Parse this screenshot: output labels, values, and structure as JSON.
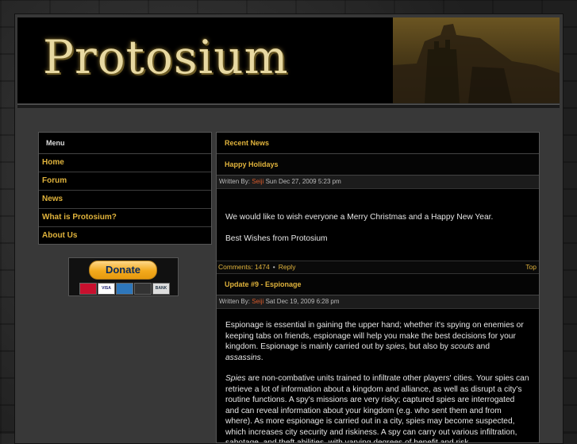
{
  "site": {
    "title": "Protosium"
  },
  "menu": {
    "heading": "Menu",
    "items": [
      {
        "label": "Home"
      },
      {
        "label": "Forum"
      },
      {
        "label": "News"
      },
      {
        "label": "What is Protosium?"
      },
      {
        "label": "About Us"
      }
    ]
  },
  "donate": {
    "button_label": "Donate",
    "cards": [
      "MasterCard",
      "VISA",
      "AMEX",
      "DISCOVER",
      "BANK"
    ]
  },
  "news": {
    "heading": "Recent News",
    "posts": [
      {
        "title": "Happy Holidays",
        "written_by_label": "Written By:",
        "author": "Seiji",
        "date": "Sun Dec 27, 2009 5:23 pm",
        "paragraphs": [
          "We would like to wish everyone a Merry Christmas and a Happy New Year.",
          "Best Wishes from Protosium"
        ],
        "comments_label": "Comments: 1474",
        "separator": "•",
        "reply_label": "Reply",
        "top_label": "Top"
      },
      {
        "title": "Update #9 - Espionage",
        "written_by_label": "Written By:",
        "author": "Seiji",
        "date": "Sat Dec 19, 2009 6:28 pm",
        "p1_a": "Espionage is essential in gaining the upper hand; whether it's spying on enemies or keeping tabs on friends, espionage will help you make the best decisions for your kingdom. Espionage is mainly carried out by ",
        "p1_spies": "spies",
        "p1_b": ", but also by ",
        "p1_scouts": "scouts",
        "p1_c": " and ",
        "p1_assassins": "assassins",
        "p1_d": ".",
        "p2_spies": "Spies",
        "p2_text": " are non-combative units trained to infiltrate other players' cities. Your spies can retrieve a lot of information about a kingdom and alliance, as well as disrupt a city's routine functions. A spy's missions are very risky; captured spies are interrogated and can reveal information about your kingdom (e.g. who sent them and from where). As more espionage is carried out in a city, spies may become suspected, which increases city security and riskiness. A spy can carry out various infiltration, sabotage, and theft abilities, with varying degrees of benefit and risk."
      }
    ]
  },
  "colors": {
    "accent": "#e0b33c",
    "author": "#d85a2a",
    "panel": "#000000"
  }
}
